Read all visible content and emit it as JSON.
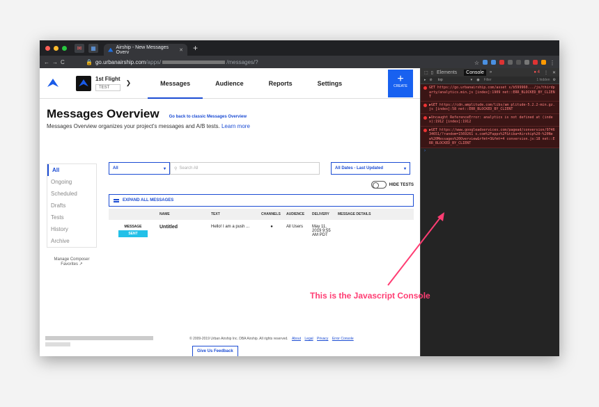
{
  "browser": {
    "tab_title": "Airship - New Messages Overv",
    "new_tab": "+",
    "url_domain": "go.urbanairship.com",
    "url_path_start": "/apps/",
    "url_path_end": "/messages/?"
  },
  "app": {
    "project_name": "1st Flight",
    "project_badge": "TEST",
    "nav": [
      "Messages",
      "Audience",
      "Reports",
      "Settings"
    ],
    "create_label": "CREATE",
    "title": "Messages Overview",
    "back_link": "Go back to classic Messages Overview",
    "subtitle": "Messages Overview organizes your project's messages and A/B tests.",
    "learn_more": "Learn more",
    "sidebar": [
      "All",
      "Ongoing",
      "Scheduled",
      "Drafts",
      "Tests",
      "History",
      "Archive"
    ],
    "manage_composer": "Manage Composer Favorites",
    "filter_type": "All",
    "search_placeholder": "Search All",
    "date_filter": "All Dates - Last Updated",
    "hide_tests": "HIDE TESTS",
    "expand_all": "EXPAND ALL MESSAGES",
    "columns": [
      "",
      "NAME",
      "TEXT",
      "CHANNELS",
      "AUDIENCE",
      "DELIVERY",
      "MESSAGE DETAILS"
    ],
    "row": {
      "type": "MESSAGE",
      "status": "SENT",
      "name": "Untitled",
      "text": "Hello! I am a push ...",
      "audience": "All Users",
      "delivery": "May 11, 2019 9:55 AM PDT"
    },
    "footer": {
      "copyright": "© 2009-2019 Urban Airship Inc. DBA Airship. All rights reserved.",
      "links": [
        "About",
        "Legal",
        "Privacy",
        "Error Console"
      ],
      "feedback": "Give Us Feedback"
    }
  },
  "devtools": {
    "tabs": [
      "Elements",
      "Console"
    ],
    "error_count": "4",
    "context": "top",
    "filter": "Filter",
    "hidden": "1 hidden",
    "messages": [
      "GET https://go.urbanairship.com/asset s/b599960.../js/thirdparty/analytics.min.js [index]:1909 net::ERR_BLOCKED_BY_CLIENT",
      "▶GET https://cdn.amplitude.com/libs/am plitude-5.2.2-min.gz.js [index]:58 net::ERR_BLOCKED_BY_CLIENT",
      "▶Uncaught ReferenceError: analytics is not defined at (index):1912 [index]:1912",
      "▶GET https://www.googleadservices.com/pagead/conversion/974634651/?random=1569261 s.com%2Fapps%2F&tiba=Airship%20-%20New%20Messages%20Overview&rfmt=3&fmt=4 conversion.js:18 net::ERR_BLOCKED_BY_CLIENT"
    ]
  },
  "annotation": "This is the Javascript Console",
  "colors": {
    "accent": "#1a4bd3",
    "create": "#1861f0",
    "annotation": "#ff3d73"
  }
}
